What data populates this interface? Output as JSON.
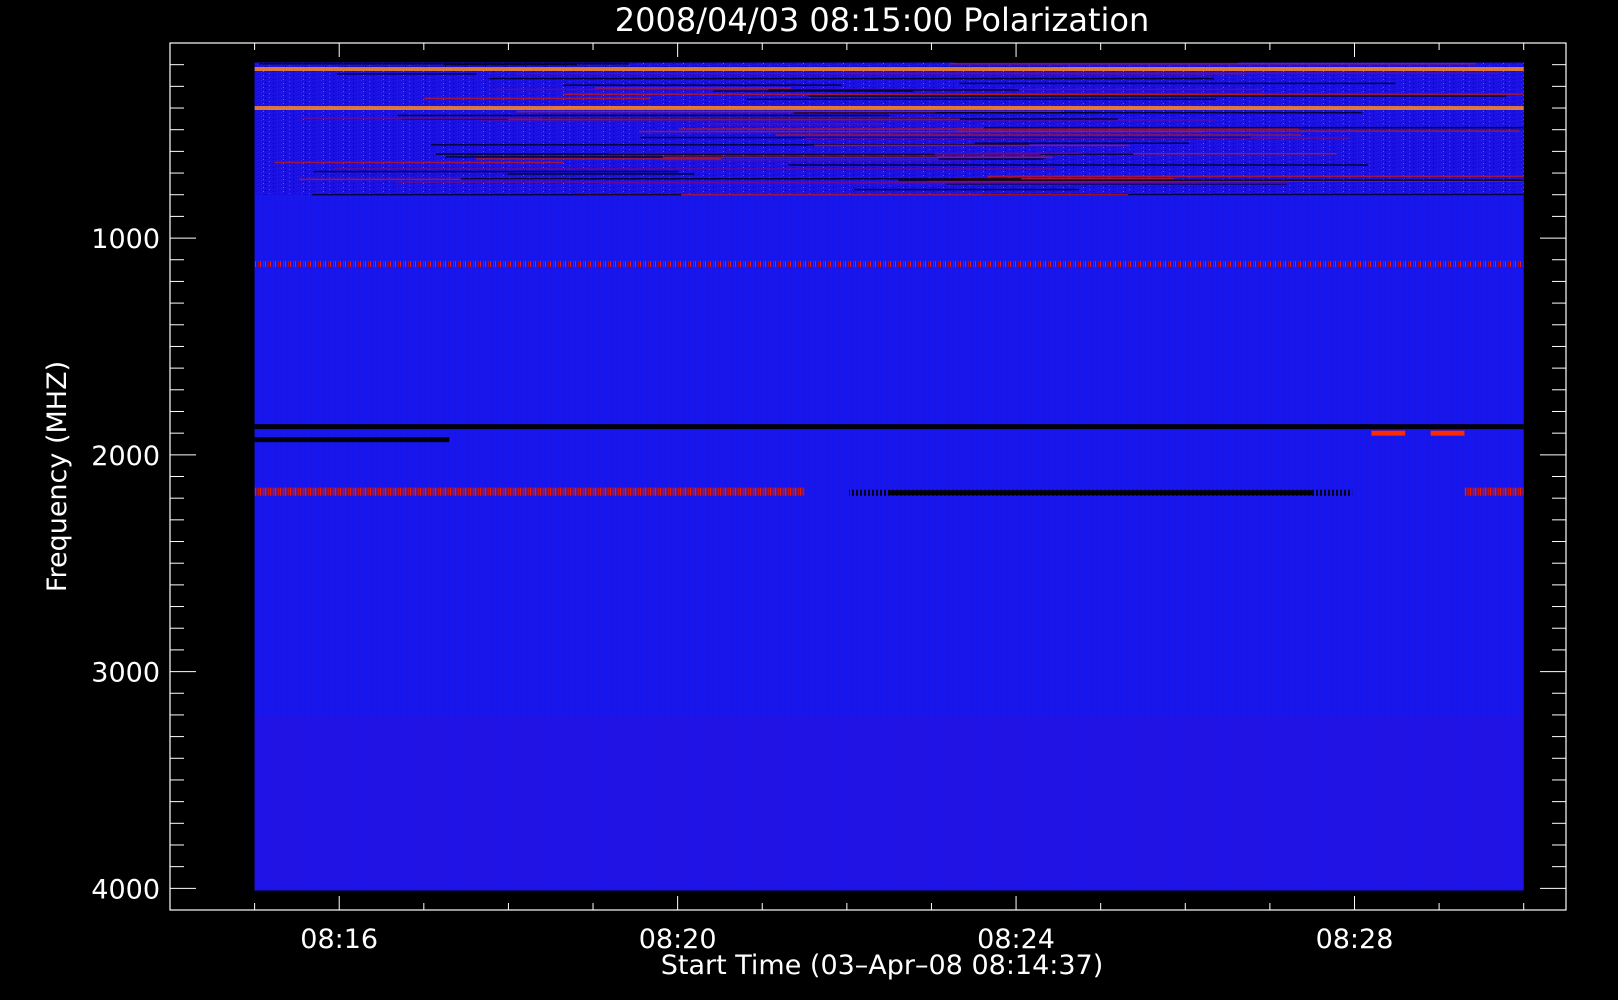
{
  "chart_data": {
    "type": "heatmap",
    "title": "2008/04/03 08:15:00 Polarization",
    "xlabel": "Start Time (03–Apr–08 08:14:37)",
    "ylabel": "Frequency (MHZ)",
    "x_major_ticks": [
      {
        "minutes": 16,
        "label": "08:16"
      },
      {
        "minutes": 20,
        "label": "08:20"
      },
      {
        "minutes": 24,
        "label": "08:24"
      },
      {
        "minutes": 28,
        "label": "08:28"
      }
    ],
    "x_minor_step_minutes": 1,
    "x_range_minutes": [
      14.0,
      30.5
    ],
    "data_x_range_minutes": [
      15.0,
      30.0
    ],
    "y_major_ticks": [
      {
        "value": 1000,
        "label": "1000"
      },
      {
        "value": 2000,
        "label": "2000"
      },
      {
        "value": 3000,
        "label": "3000"
      },
      {
        "value": 4000,
        "label": "4000"
      }
    ],
    "y_minor_step": 100,
    "y_range_mhz": [
      100,
      4100
    ],
    "y_inverted": true,
    "data_y_range_mhz": [
      190,
      4010
    ],
    "colormap": {
      "background": "#1414ee",
      "low": "#000000",
      "high": "#ff2a00",
      "peak": "#ffe066"
    },
    "features": [
      {
        "kind": "noisy_band",
        "freq_mhz": [
          190,
          800
        ],
        "intensity": "high"
      },
      {
        "kind": "bright_line",
        "freq_mhz": 400,
        "time_min": [
          15.0,
          30.0
        ],
        "color": "orange"
      },
      {
        "kind": "bright_line",
        "freq_mhz": 220,
        "time_min": [
          15.0,
          30.0
        ],
        "color": "orange"
      },
      {
        "kind": "dashed_line",
        "freq_mhz": 1120,
        "time_min": [
          15.0,
          30.0
        ],
        "color": "red"
      },
      {
        "kind": "dark_line",
        "freq_mhz": 1870,
        "time_min": [
          15.0,
          30.0
        ]
      },
      {
        "kind": "dark_line",
        "freq_mhz": 1930,
        "time_min": [
          15.0,
          17.3
        ]
      },
      {
        "kind": "red_line",
        "freq_mhz": 2170,
        "time_min": [
          15.0,
          21.5
        ]
      },
      {
        "kind": "dark_line",
        "freq_mhz": 2175,
        "time_min": [
          22.5,
          27.5
        ]
      },
      {
        "kind": "red_line",
        "freq_mhz": 2170,
        "time_min": [
          29.3,
          30.0
        ]
      },
      {
        "kind": "red_spot",
        "freq_mhz": 1900,
        "time_min": [
          28.2,
          28.6
        ]
      },
      {
        "kind": "red_spot",
        "freq_mhz": 1900,
        "time_min": [
          28.9,
          29.3
        ]
      }
    ]
  }
}
